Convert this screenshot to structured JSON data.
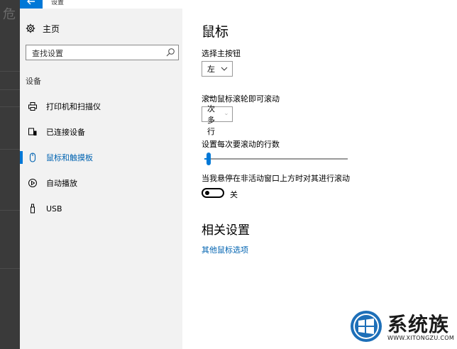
{
  "window": {
    "title": "设置"
  },
  "sidebar": {
    "home_label": "主页",
    "search_placeholder": "查找设置",
    "section_label": "设备",
    "items": [
      {
        "label": "打印机和扫描仪",
        "icon": "printer-icon",
        "active": false
      },
      {
        "label": "已连接设备",
        "icon": "connected-devices-icon",
        "active": false
      },
      {
        "label": "鼠标和触摸板",
        "icon": "mouse-icon",
        "active": true
      },
      {
        "label": "自动播放",
        "icon": "autoplay-icon",
        "active": false
      },
      {
        "label": "USB",
        "icon": "usb-icon",
        "active": false
      }
    ]
  },
  "main": {
    "title": "鼠标",
    "primary_button": {
      "label": "选择主按钮",
      "value": "左"
    },
    "scroll_mode": {
      "label": "滚动鼠标滚轮即可滚动",
      "value": "一次多行"
    },
    "scroll_lines": {
      "label": "设置每次要滚动的行数",
      "value_fraction": 0.03
    },
    "inactive_scroll": {
      "label": "当我悬停在非活动窗口上方时对其进行滚动",
      "state_label": "关",
      "on": false
    },
    "related": {
      "title": "相关设置",
      "link": "其他鼠标选项"
    }
  },
  "watermark": {
    "brand": "系统族",
    "url": "WWW.XITONGZU.COM"
  },
  "colors": {
    "accent": "#0078d7",
    "link": "#0063b1",
    "sidebar_bg": "#f2f2f2"
  }
}
